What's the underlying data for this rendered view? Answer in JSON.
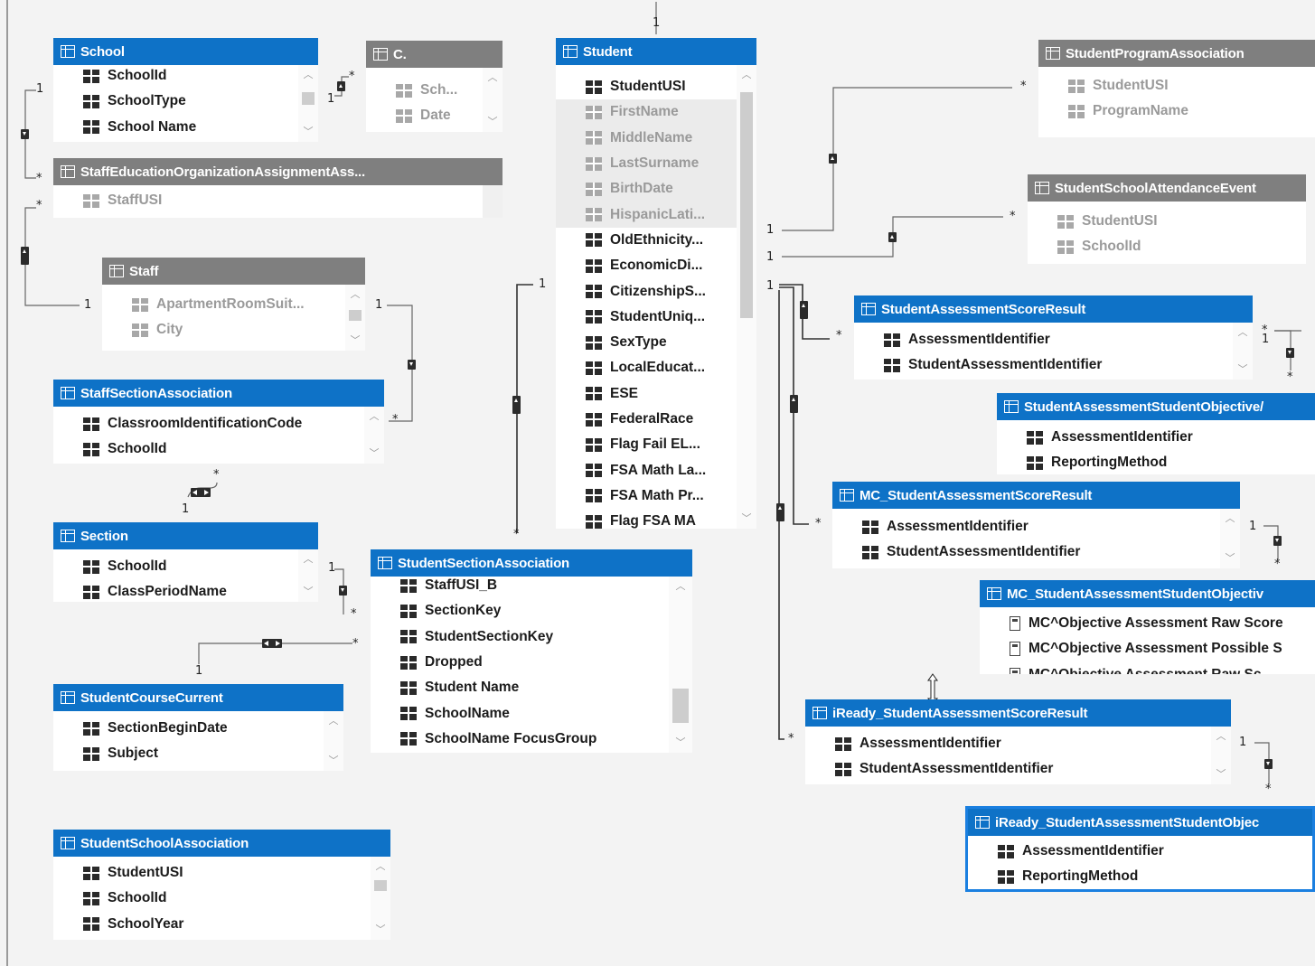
{
  "top_one_label": "1",
  "tables": {
    "school": {
      "title": "School",
      "rows": [
        "SchoolId",
        "SchoolType",
        "School Name"
      ]
    },
    "c": {
      "title": "C.",
      "rows": [
        "Sch...",
        "Date"
      ]
    },
    "staff_edorg": {
      "title": "StaffEducationOrganizationAssignmentAss...",
      "rows": [
        "StaffUSI"
      ]
    },
    "staff": {
      "title": "Staff",
      "rows": [
        "ApartmentRoomSuit...",
        "City"
      ]
    },
    "staff_section": {
      "title": "StaffSectionAssociation",
      "rows": [
        "ClassroomIdentificationCode",
        "SchoolId"
      ]
    },
    "section": {
      "title": "Section",
      "rows": [
        "SchoolId",
        "ClassPeriodName"
      ]
    },
    "student_course": {
      "title": "StudentCourseCurrent",
      "rows": [
        "SectionBeginDate",
        "Subject"
      ]
    },
    "student_school": {
      "title": "StudentSchoolAssociation",
      "rows": [
        "StudentUSI",
        "SchoolId",
        "SchoolYear"
      ]
    },
    "student": {
      "title": "Student",
      "rows": [
        "StudentUSI",
        "FirstName",
        "MiddleName",
        "LastSurname",
        "BirthDate",
        "HispanicLati...",
        "OldEthnicity...",
        "EconomicDi...",
        "CitizenshipS...",
        "StudentUniq...",
        "SexType",
        "LocalEducat...",
        "ESE",
        "FederalRace",
        "Flag Fail EL...",
        "FSA Math La...",
        "FSA Math Pr...",
        "Flag FSA MA"
      ]
    },
    "student_section": {
      "title": "StudentSectionAssociation",
      "rows": [
        "StaffUSI_B",
        "SectionKey",
        "StudentSectionKey",
        "Dropped",
        "Student Name",
        "SchoolName",
        "SchoolName FocusGroup"
      ]
    },
    "student_program": {
      "title": "StudentProgramAssociation",
      "rows": [
        "StudentUSI",
        "ProgramName"
      ]
    },
    "attendance": {
      "title": "StudentSchoolAttendanceEvent",
      "rows": [
        "StudentUSI",
        "SchoolId"
      ]
    },
    "score_result": {
      "title": "StudentAssessmentScoreResult",
      "rows": [
        "AssessmentIdentifier",
        "StudentAssessmentIdentifier"
      ]
    },
    "student_objective": {
      "title": "StudentAssessmentStudentObjective/",
      "rows": [
        "AssessmentIdentifier",
        "ReportingMethod"
      ]
    },
    "mc_score": {
      "title": "MC_StudentAssessmentScoreResult",
      "rows": [
        "AssessmentIdentifier",
        "StudentAssessmentIdentifier"
      ]
    },
    "mc_objective": {
      "title": "MC_StudentAssessmentStudentObjectiv",
      "rows": [
        "MC^Objective Assessment Raw Score",
        "MC^Objective Assessment Possible S",
        "MC^Objective Assessment Raw Sc"
      ]
    },
    "iready_score": {
      "title": "iReady_StudentAssessmentScoreResult",
      "rows": [
        "AssessmentIdentifier",
        "StudentAssessmentIdentifier"
      ]
    },
    "iready_objective": {
      "title": "iReady_StudentAssessmentStudentObjec",
      "rows": [
        "AssessmentIdentifier",
        "ReportingMethod"
      ]
    }
  },
  "cardinality": {
    "one": "1",
    "many": "*"
  },
  "colors": {
    "header_blue": "#0e72c7",
    "header_gray": "#7f7f7f",
    "selected_border": "#1a7fe0",
    "canvas": "#f3f3f3"
  }
}
